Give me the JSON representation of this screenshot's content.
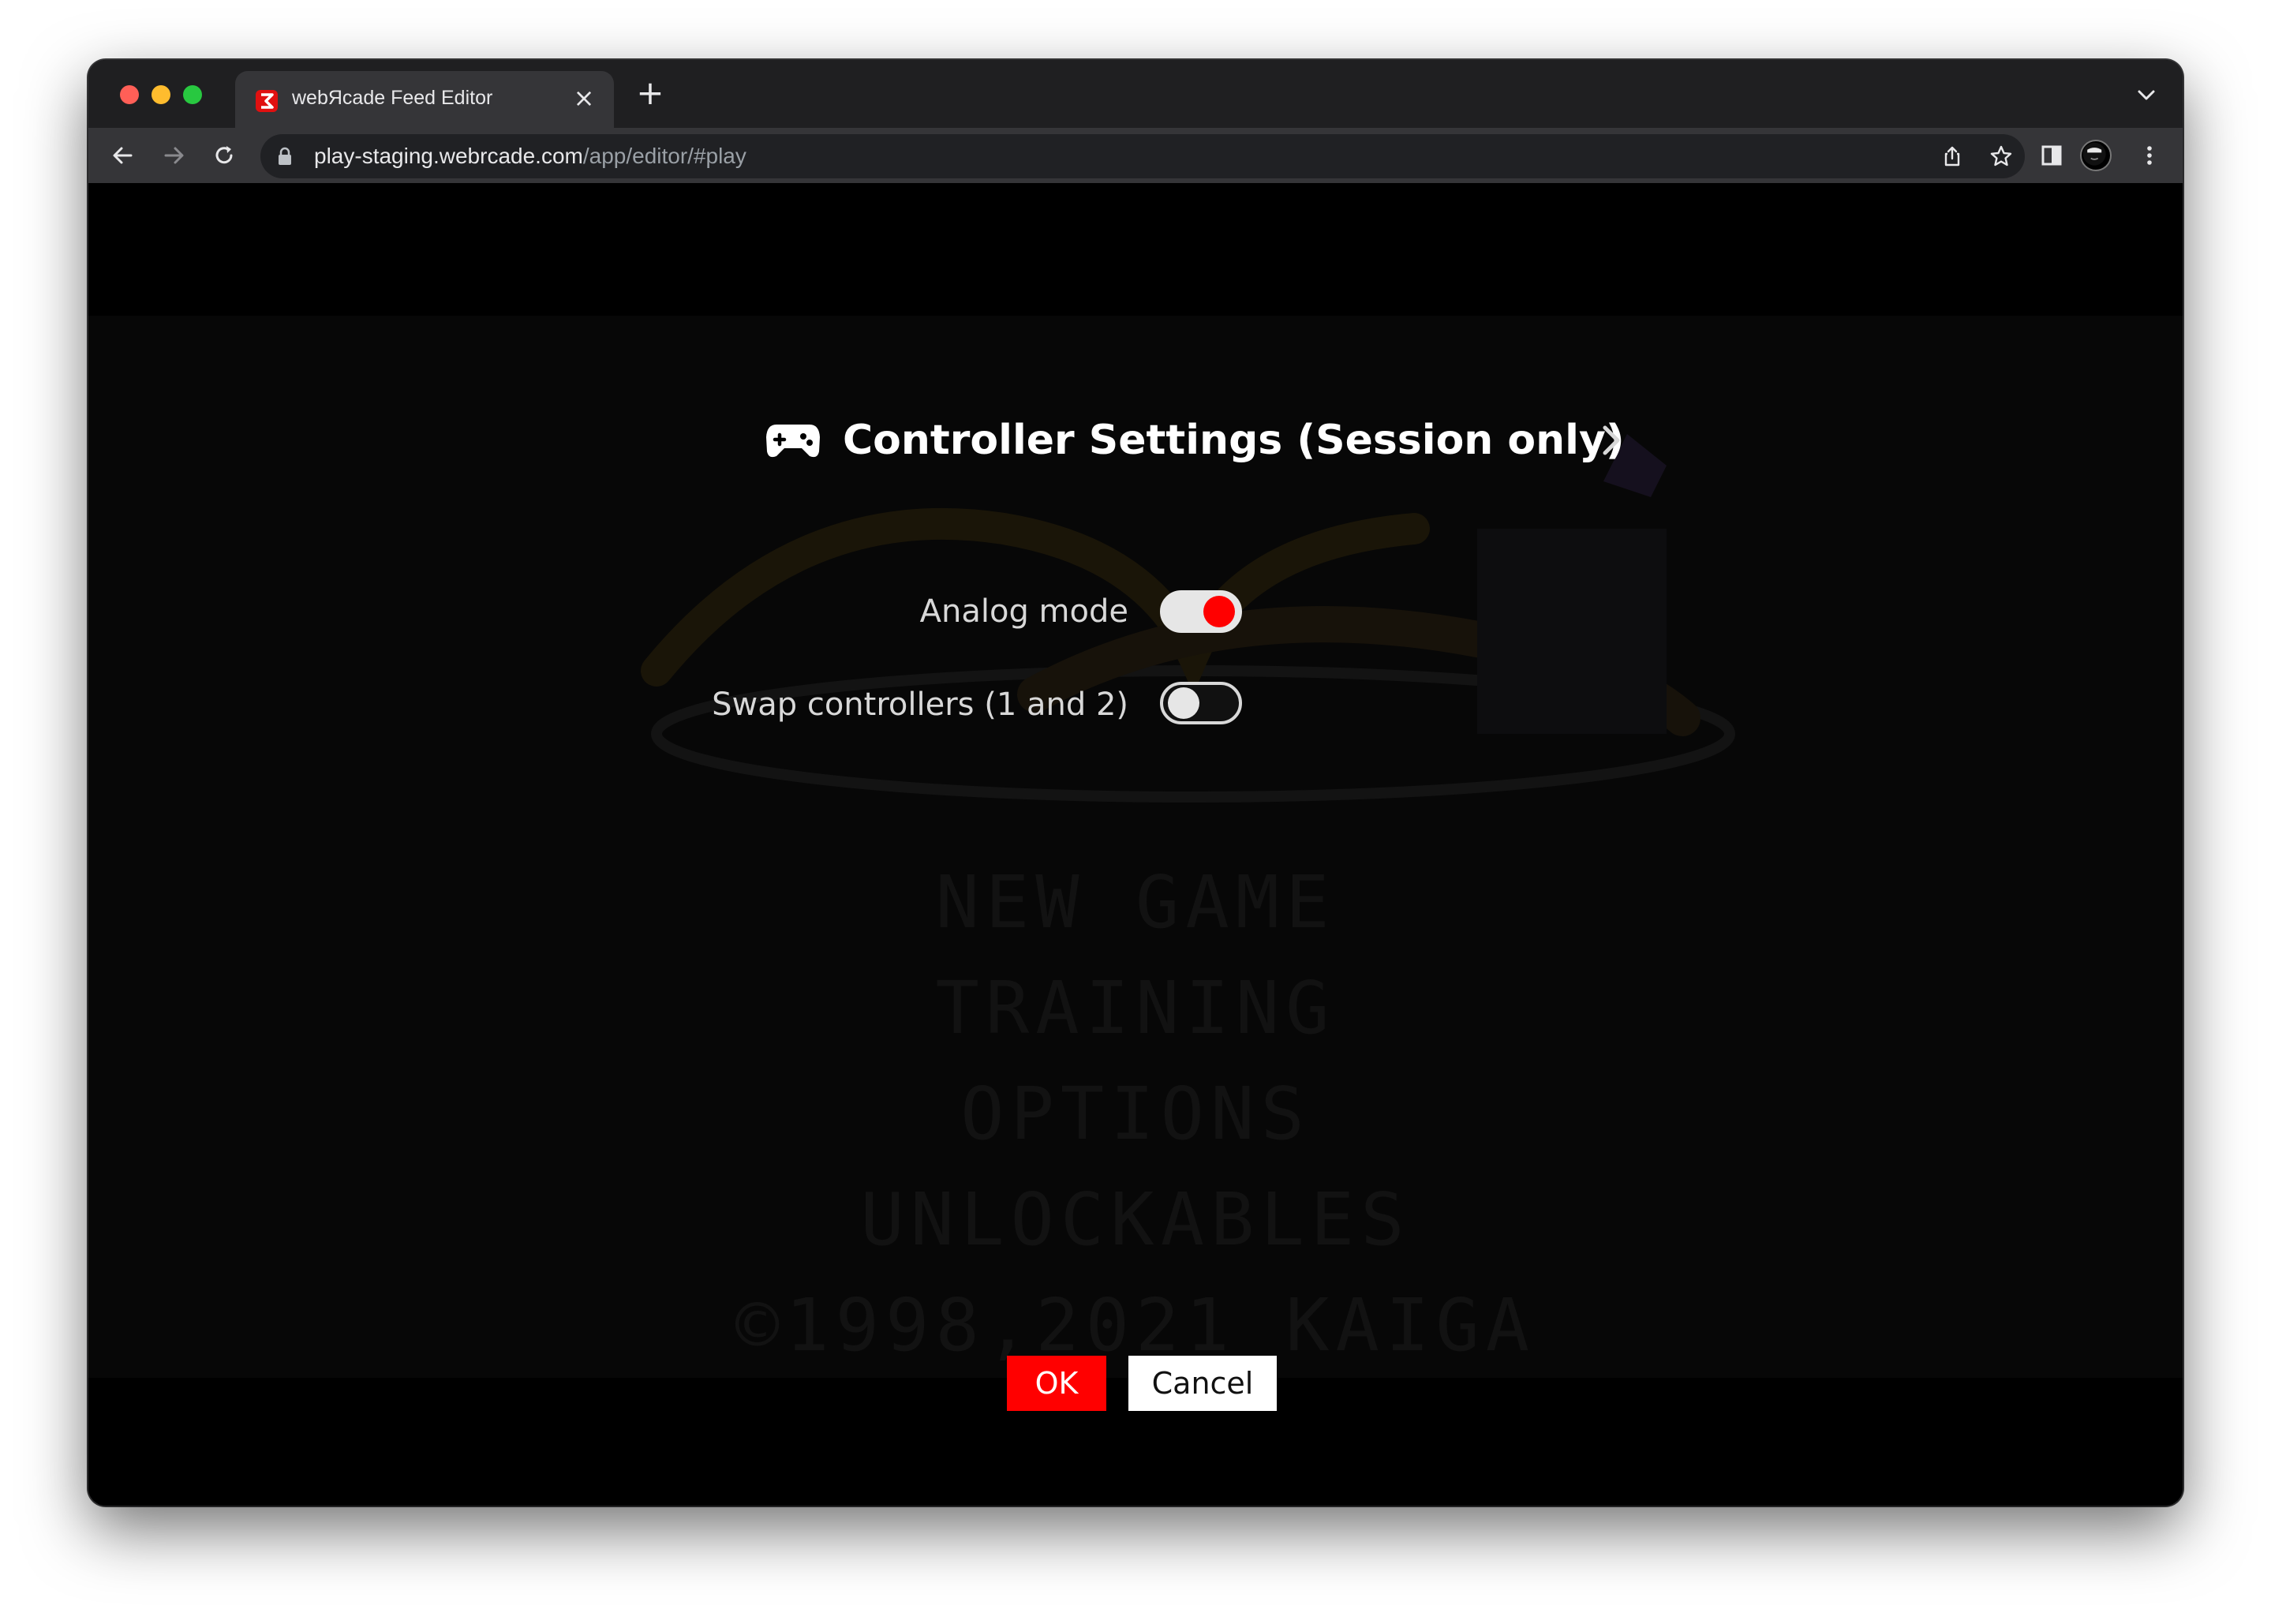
{
  "browser": {
    "tab": {
      "title": "webЯcade Feed Editor",
      "close_glyph": "×"
    },
    "new_tab_glyph": "+",
    "url": {
      "host": "play-staging.webrcade.com",
      "path": "/app/editor/#play"
    },
    "icons": [
      "back-icon",
      "forward-icon",
      "reload-icon",
      "lock-icon",
      "share-icon",
      "star-icon",
      "side-panel-icon",
      "profile-avatar",
      "more-menu-icon",
      "tab-list-chevron-icon"
    ]
  },
  "game_background": {
    "menu": [
      "NEW GAME",
      "TRAINING",
      "OPTIONS",
      "UNLOCKABLES"
    ],
    "copyright": "©1998,2021 KAIGA"
  },
  "dialog": {
    "title": "Controller Settings (Session only)",
    "settings": [
      {
        "label": "Analog mode",
        "enabled": true
      },
      {
        "label": "Swap controllers (1 and 2)",
        "enabled": false
      }
    ],
    "ok_label": "OK",
    "cancel_label": "Cancel"
  },
  "colors": {
    "accent": "#ff0000",
    "chrome_dark": "#1f1f21",
    "toolbar": "#353538",
    "text": "#ffffff"
  }
}
